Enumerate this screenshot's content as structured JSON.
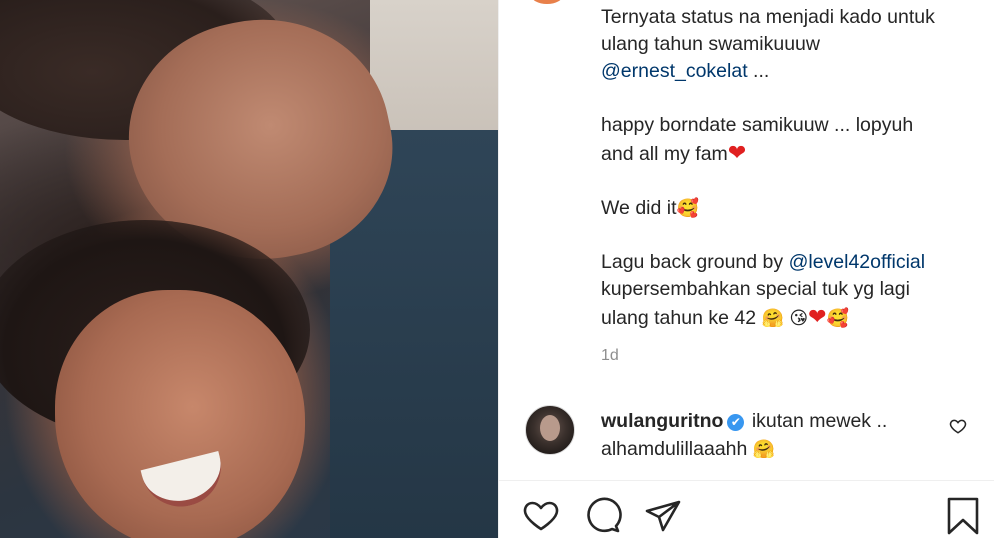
{
  "post": {
    "caption_lines": [
      "Ternyata status na menjadi kado untuk",
      "ulang tahun swamikuuuw"
    ],
    "caption_mention_1": "@ernest_cokelat",
    "caption_mention_1_suffix": " ...",
    "caption_para2_line1": "happy borndate samikuuw ... lopyuh",
    "caption_para2_line2": "and all my fam",
    "caption_para3": "We did it",
    "caption_para4_prefix": "Lagu back ground by ",
    "caption_mention_2": "@level42official",
    "caption_para4_line2": "kupersembahkan special tuk yg lagi",
    "caption_para4_line3": "ulang tahun ke 42 ",
    "emoji_red_heart": "❤",
    "emoji_smiling_hearts": "🥰",
    "emoji_hugging": "🤗",
    "emoji_kiss": "😘",
    "timestamp": "1d"
  },
  "comment": {
    "username": "wulanguritno",
    "verified_icon": "✔",
    "text_line1": " ikutan mewek ..",
    "text_line2": "alhamdulillaaahh ",
    "emoji": "🤗",
    "like_icon": "heart-outline-icon"
  },
  "actions": {
    "like_icon": "heart-outline-icon",
    "comment_icon": "comment-bubble-icon",
    "share_icon": "paper-plane-icon",
    "save_icon": "bookmark-icon"
  },
  "colors": {
    "mention": "#00376b",
    "text": "#262626",
    "muted": "#8e8e8e",
    "verified": "#3897f0"
  }
}
